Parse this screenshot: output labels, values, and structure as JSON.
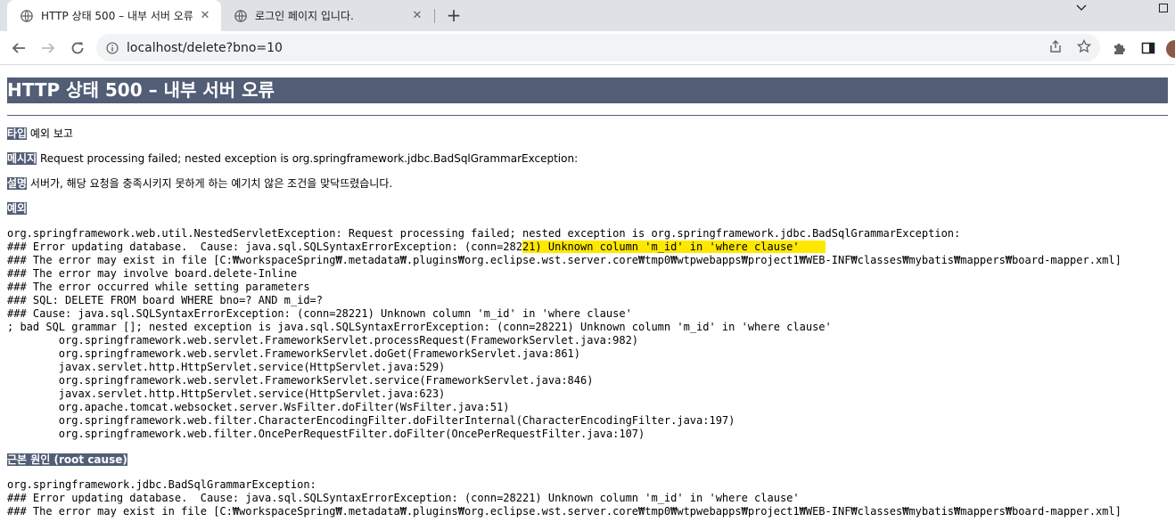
{
  "browser": {
    "tabs": [
      {
        "title": "HTTP 상태 500 – 내부 서버 오류",
        "active": true
      },
      {
        "title": "로그인 페이지 입니다.",
        "active": false
      }
    ],
    "url": "localhost/delete?bno=10",
    "new_tab_glyph": "+",
    "close_glyph": "✕"
  },
  "error": {
    "title": "HTTP 상태 500 – 내부 서버 오류",
    "type_label": "타입",
    "type_value": "예외 보고",
    "message_label": "메시지",
    "message_value": "Request processing failed; nested exception is org.springframework.jdbc.BadSqlGrammarException:",
    "description_label": "설명",
    "description_value": "서버가, 해당 요청을 충족시키지 못하게 하는 예기치 않은 조건을 맞닥뜨렸습니다.",
    "exception_label": "예외",
    "exception_trace": {
      "line1": "org.springframework.web.util.NestedServletException: Request processing failed; nested exception is org.springframework.jdbc.BadSqlGrammarException:",
      "line2_pre": "### Error updating database.  Cause: java.sql.SQLSyntaxErrorException: (conn=282",
      "line2_highlight": "21) Unknown column 'm_id' in 'where clause'    ",
      "rest": "### The error may exist in file [C:₩workspaceSpring₩.metadata₩.plugins₩org.eclipse.wst.server.core₩tmp0₩wtpwebapps₩project1₩WEB-INF₩classes₩mybatis₩mappers₩board-mapper.xml]\n### The error may involve board.delete-Inline\n### The error occurred while setting parameters\n### SQL: DELETE FROM board WHERE bno=? AND m_id=?\n### Cause: java.sql.SQLSyntaxErrorException: (conn=28221) Unknown column 'm_id' in 'where clause'\n; bad SQL grammar []; nested exception is java.sql.SQLSyntaxErrorException: (conn=28221) Unknown column 'm_id' in 'where clause'\n\torg.springframework.web.servlet.FrameworkServlet.processRequest(FrameworkServlet.java:982)\n\torg.springframework.web.servlet.FrameworkServlet.doGet(FrameworkServlet.java:861)\n\tjavax.servlet.http.HttpServlet.service(HttpServlet.java:529)\n\torg.springframework.web.servlet.FrameworkServlet.service(FrameworkServlet.java:846)\n\tjavax.servlet.http.HttpServlet.service(HttpServlet.java:623)\n\torg.apache.tomcat.websocket.server.WsFilter.doFilter(WsFilter.java:51)\n\torg.springframework.web.filter.CharacterEncodingFilter.doFilterInternal(CharacterEncodingFilter.java:197)\n\torg.springframework.web.filter.OncePerRequestFilter.doFilter(OncePerRequestFilter.java:107)"
    },
    "root_cause_label": "근본 원인 (root cause)",
    "root_cause_trace": "org.springframework.jdbc.BadSqlGrammarException:\n### Error updating database.  Cause: java.sql.SQLSyntaxErrorException: (conn=28221) Unknown column 'm_id' in 'where clause'\n### The error may exist in file [C:₩workspaceSpring₩.metadata₩.plugins₩org.eclipse.wst.server.core₩tmp0₩wtpwebapps₩project1₩WEB-INF₩classes₩mybatis₩mappers₩board-mapper.xml]"
  },
  "colors": {
    "label_bg": "#525d76",
    "highlight": "#ffe800",
    "tabstrip": "#dee1e6"
  }
}
